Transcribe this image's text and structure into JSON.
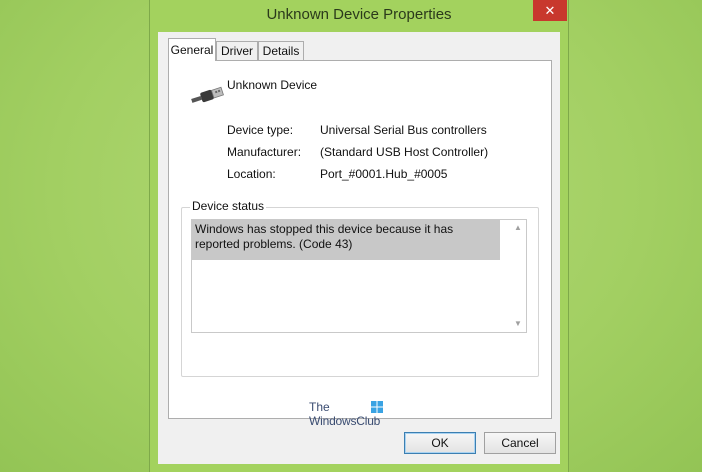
{
  "window": {
    "title": "Unknown Device Properties",
    "close_glyph": "✕"
  },
  "tabs": [
    {
      "label": "General",
      "active": true
    },
    {
      "label": "Driver",
      "active": false
    },
    {
      "label": "Details",
      "active": false
    }
  ],
  "device": {
    "name": "Unknown Device",
    "icon": "usb-plug-icon"
  },
  "properties": [
    {
      "label": "Device type:",
      "value": "Universal Serial Bus controllers"
    },
    {
      "label": "Manufacturer:",
      "value": "(Standard USB Host Controller)"
    },
    {
      "label": "Location:",
      "value": "Port_#0001.Hub_#0005"
    }
  ],
  "status": {
    "group_label": "Device status",
    "text": "Windows has stopped this device because it has reported problems. (Code 43)"
  },
  "watermark": {
    "line1": "The",
    "line2": "WindowsClub"
  },
  "buttons": {
    "ok": "OK",
    "cancel": "Cancel"
  },
  "colors": {
    "desktop": "#a8d26b",
    "close_button": "#c8382d",
    "status_highlight": "#c8c8c8"
  }
}
